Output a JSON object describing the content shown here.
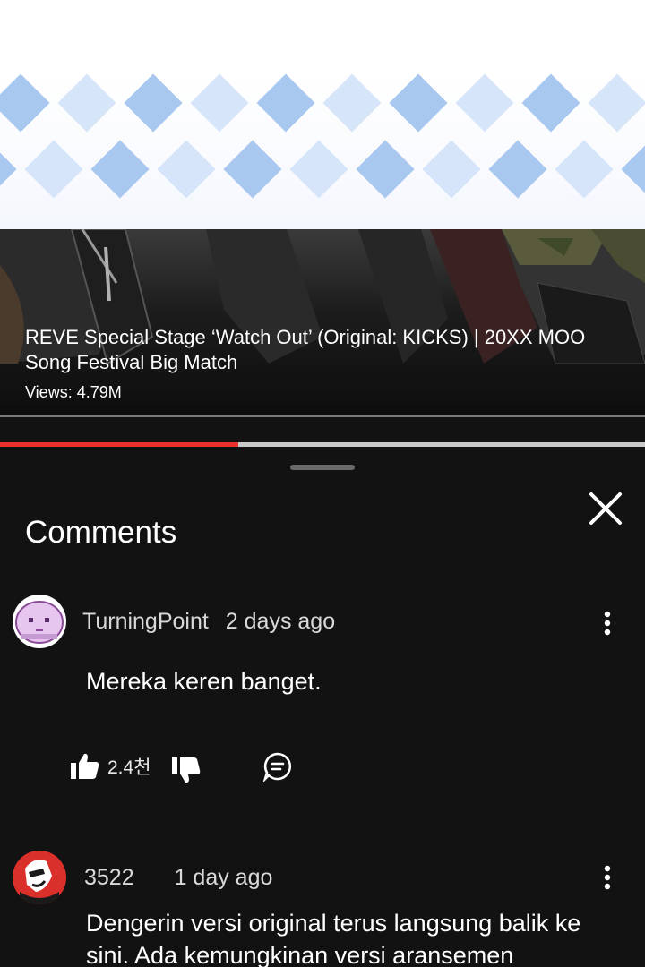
{
  "video": {
    "title": "REVE Special Stage ‘Watch Out’ (Original: KICKS) | 20XX MOO Song Festival Big Match",
    "views": "Views: 4.79M",
    "progress_fraction": 0.37
  },
  "panel": {
    "title": "Comments"
  },
  "comments": [
    {
      "author": "TurningPoint",
      "time": "2 days ago",
      "text": "Mereka keren banget.",
      "likes": "2.4천"
    },
    {
      "author": "3522",
      "time": "1 day ago",
      "text": "Dengerin versi original terus langsung balik ke sini. Ada kemungkinan versi aransemen"
    }
  ],
  "icons": {
    "close": "close-icon",
    "more": "more-vert-icon",
    "like": "thumbs-up-icon",
    "dislike": "thumbs-down-icon",
    "reply": "comment-reply-icon"
  },
  "colors": {
    "background": "#121212",
    "progress": "#e9302d",
    "diamond_dark": "#a9c8ef",
    "diamond_light": "#d6e5f9"
  }
}
